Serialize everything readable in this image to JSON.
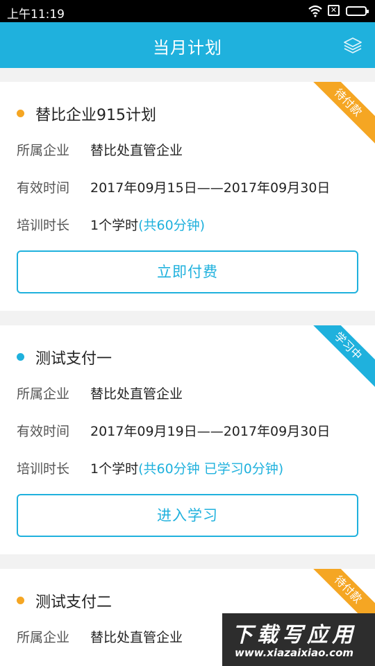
{
  "status_bar": {
    "time": "上午11:19"
  },
  "app_bar": {
    "title": "当月计划",
    "menu_icon": "layers-icon"
  },
  "plans": [
    {
      "name": "替比企业915计划",
      "dot_color": "#f5a623",
      "badge": "待付款",
      "badge_color": "#f5a623",
      "company_label": "所属企业",
      "company": "替比处直管企业",
      "period_label": "有效时间",
      "period": "2017年09月15日——2017年09月30日",
      "duration_label": "培训时长",
      "duration": "1个学时",
      "duration_extra": "(共60分钟)",
      "action": "立即付费"
    },
    {
      "name": "测试支付一",
      "dot_color": "#1fb1dd",
      "badge": "学习中",
      "badge_color": "#1fb1dd",
      "company_label": "所属企业",
      "company": "替比处直管企业",
      "period_label": "有效时间",
      "period": "2017年09月19日——2017年09月30日",
      "duration_label": "培训时长",
      "duration": "1个学时",
      "duration_extra": "(共60分钟  已学习0分钟)",
      "action": "进入学习"
    },
    {
      "name": "测试支付二",
      "dot_color": "#f5a623",
      "badge": "待付款",
      "badge_color": "#f5a623",
      "company_label": "所属企业",
      "company": "替比处直管企业"
    }
  ],
  "watermark": {
    "title": "下载写应用",
    "url": "www.xiazaixiao.com"
  }
}
